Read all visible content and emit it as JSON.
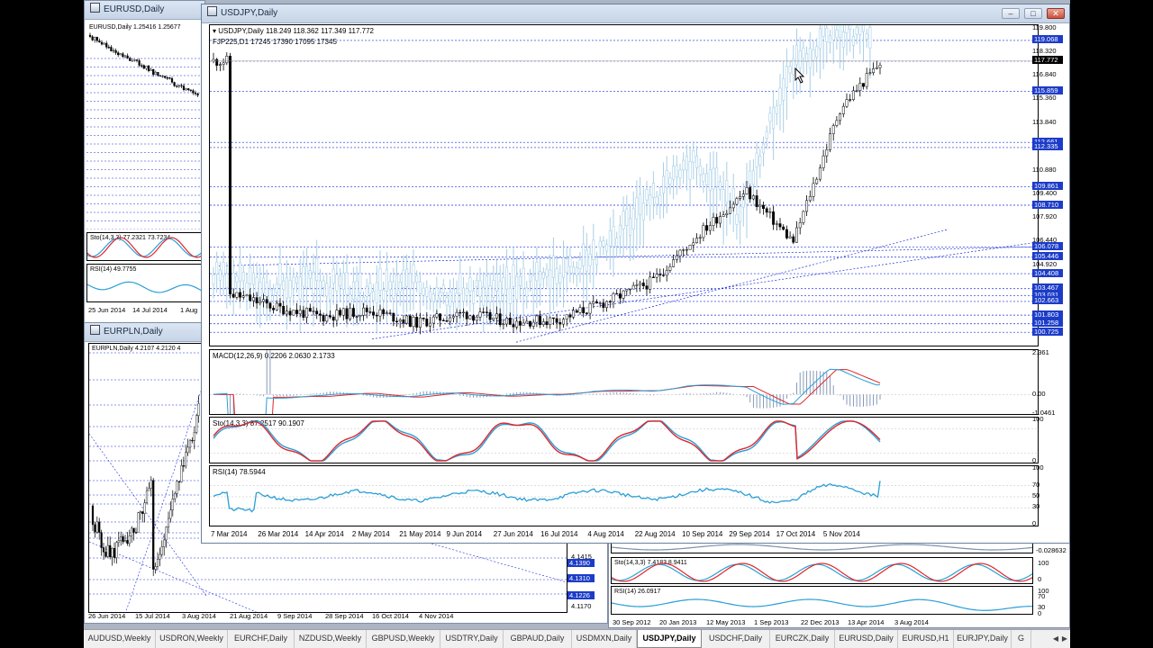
{
  "colors": {
    "candle_up": "#ffffff",
    "candle": "#000000",
    "ghost": "#a9cfe6",
    "level_line": "#1a2ed8",
    "macd_signal": "#e0262b",
    "macd_main": "#2a9fd6",
    "stoch_k": "#e0262b",
    "stoch_d": "#2a9fd6",
    "rsi": "#2a9fd6",
    "price_box": "#1c3cc8"
  },
  "bg_windows": {
    "eurusd": {
      "title": "EURUSD,Daily",
      "header": "EURUSD,Daily  1.25416 1.25677",
      "stoch_label": "Sto(14,3,3) 77.2321 73.7234",
      "rsi_label": "RSI(14) 49.7755",
      "dates": [
        "25 Jun 2014",
        "14 Jul 2014",
        "1 Aug"
      ]
    },
    "eurpln": {
      "title": "EURPLN,Daily",
      "header": "EURPLN,Daily  4.2107 4.2120 4",
      "dates": [
        "26 Jun 2014",
        "15 Jul 2014",
        "3 Aug 2014",
        "21 Aug 2014",
        "9 Sep 2014",
        "28 Sep 2014",
        "16 Oct 2014",
        "4 Nov 2014"
      ],
      "prices": [
        "4.1415",
        "4.1390",
        "4.1310",
        "4.1226",
        "4.1170"
      ]
    },
    "lower_right": {
      "macd_value": "-0.028632",
      "stoch_label": "Sto(14,3,3) 7.4183 8.9411",
      "stoch_levels": [
        "100",
        "0"
      ],
      "rsi_label": "RSI(14) 26.0917",
      "rsi_levels": [
        "100",
        "70",
        "30",
        "0"
      ],
      "dates": [
        "30 Sep 2012",
        "20 Jan 2013",
        "12 May 2013",
        "1 Sep 2013",
        "22 Dec 2013",
        "13 Apr 2014",
        "3 Aug 2014"
      ]
    }
  },
  "main": {
    "title": "USDJPY,Daily",
    "header_line1": "USDJPY,Daily  118.249 118.362 117.349 117.772",
    "header_line2": "FJP225,D1  17245 17390 17095 17345",
    "price_axis": [
      "119.800",
      "118.320",
      "116.840",
      "115.360",
      "113.840",
      "110.880",
      "109.400",
      "107.920",
      "106.440",
      "104.920"
    ],
    "price_boxes": [
      "119.068",
      "117.772",
      "115.859",
      "112.661",
      "112.335",
      "109.861",
      "108.710",
      "106.078",
      "105.446",
      "104.408",
      "103.467",
      "103.031",
      "102.663",
      "101.803",
      "101.258",
      "100.725"
    ],
    "current_price": "117.772",
    "macd_label": "MACD(12,26,9) 0.2206 2.0630 2.1733",
    "macd_axis": [
      "2.361",
      "0.00",
      "-1.0461"
    ],
    "stoch_label": "Sto(14,3,3) 87.2517 90.1907",
    "stoch_axis": [
      "100",
      "0"
    ],
    "rsi_label": "RSI(14) 78.5944",
    "rsi_axis": [
      "100",
      "70",
      "50",
      "30",
      "0"
    ],
    "date_axis": [
      "7 Mar 2014",
      "26 Mar 2014",
      "14 Apr 2014",
      "2 May 2014",
      "21 May 2014",
      "9 Jun 2014",
      "27 Jun 2014",
      "16 Jul 2014",
      "4 Aug 2014",
      "22 Aug 2014",
      "10 Sep 2014",
      "29 Sep 2014",
      "17 Oct 2014",
      "5 Nov 2014"
    ]
  },
  "tabs": [
    "AUDUSD,Weekly",
    "USDRON,Weekly",
    "EURCHF,Daily",
    "NZDUSD,Weekly",
    "GBPUSD,Weekly",
    "USDTRY,Daily",
    "GBPAUD,Daily",
    "USDMXN,Daily",
    "USDJPY,Daily",
    "USDCHF,Daily",
    "EURCZK,Daily",
    "EURUSD,Daily",
    "EURUSD,H1",
    "EURJPY,Daily",
    "G"
  ],
  "active_tab": "USDJPY,Daily",
  "chart_data": {
    "type": "candlestick",
    "title": "USDJPY,Daily",
    "x": [
      "7 Mar 2014",
      "26 Mar 2014",
      "14 Apr 2014",
      "2 May 2014",
      "21 May 2014",
      "9 Jun 2014",
      "27 Jun 2014",
      "16 Jul 2014",
      "4 Aug 2014",
      "22 Aug 2014",
      "10 Sep 2014",
      "29 Sep 2014",
      "17 Oct 2014",
      "5 Nov 2014"
    ],
    "close_at_dates": [
      103.2,
      102.3,
      101.7,
      102.1,
      101.3,
      101.9,
      101.4,
      101.5,
      102.6,
      103.9,
      106.9,
      109.6,
      106.4,
      114.8
    ],
    "last": {
      "open": 118.249,
      "high": 118.362,
      "low": 117.349,
      "close": 117.772
    },
    "ylim": [
      100.0,
      119.8
    ],
    "indicators": {
      "macd": {
        "macd": 0.2206,
        "signal": 2.063,
        "histogram": 2.1733
      },
      "stochastic": {
        "k": 87.2517,
        "d": 90.1907
      },
      "rsi": 78.5944
    }
  }
}
